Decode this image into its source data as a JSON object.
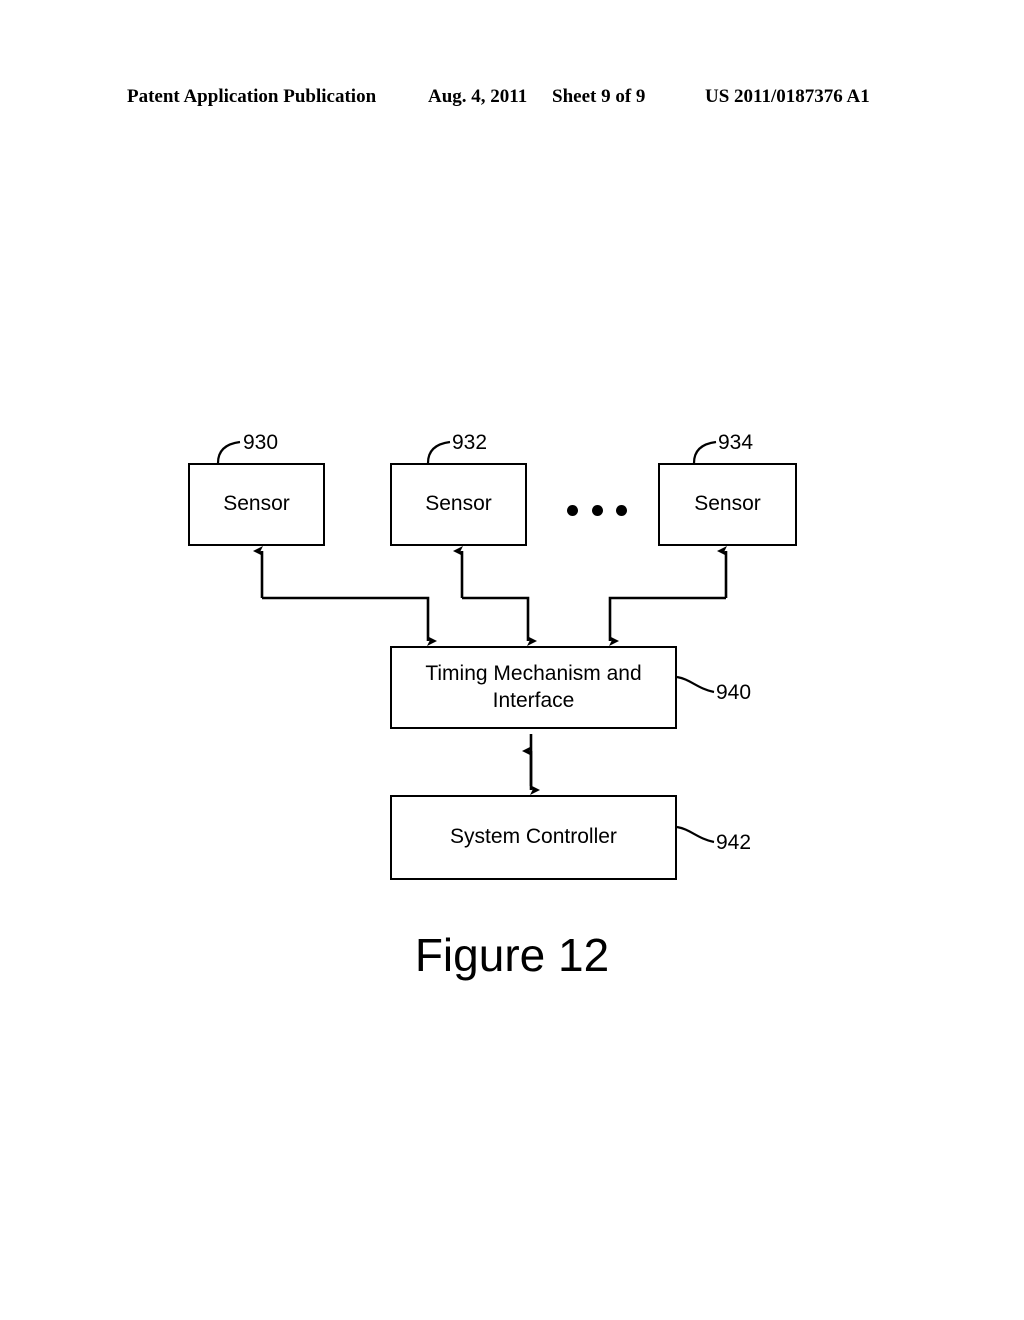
{
  "header": {
    "publication": "Patent Application Publication",
    "date": "Aug. 4, 2011",
    "sheet": "Sheet 9 of 9",
    "patent_number": "US 2011/0187376 A1"
  },
  "figure": {
    "caption": "Figure 12",
    "nodes": [
      {
        "id": "sensor-1",
        "label": "Sensor",
        "ref": "930"
      },
      {
        "id": "sensor-2",
        "label": "Sensor",
        "ref": "932"
      },
      {
        "id": "sensor-3",
        "label": "Sensor",
        "ref": "934"
      },
      {
        "id": "timing-mechanism",
        "label": "Timing Mechanism and Interface",
        "ref": "940"
      },
      {
        "id": "system-controller",
        "label": "System Controller",
        "ref": "942"
      }
    ],
    "ellipsis": "•••",
    "connections": [
      {
        "from": "timing-mechanism",
        "to": "sensor-1",
        "type": "arrow-up"
      },
      {
        "from": "timing-mechanism",
        "to": "sensor-2",
        "type": "arrow-up"
      },
      {
        "from": "timing-mechanism",
        "to": "sensor-3",
        "type": "arrow-up"
      },
      {
        "from": "sensor-1",
        "to": "timing-mechanism",
        "type": "arrow-down"
      },
      {
        "from": "sensor-2",
        "to": "timing-mechanism",
        "type": "arrow-down"
      },
      {
        "from": "sensor-3",
        "to": "timing-mechanism",
        "type": "arrow-down"
      },
      {
        "from": "timing-mechanism",
        "to": "system-controller",
        "type": "bidirectional"
      }
    ]
  }
}
